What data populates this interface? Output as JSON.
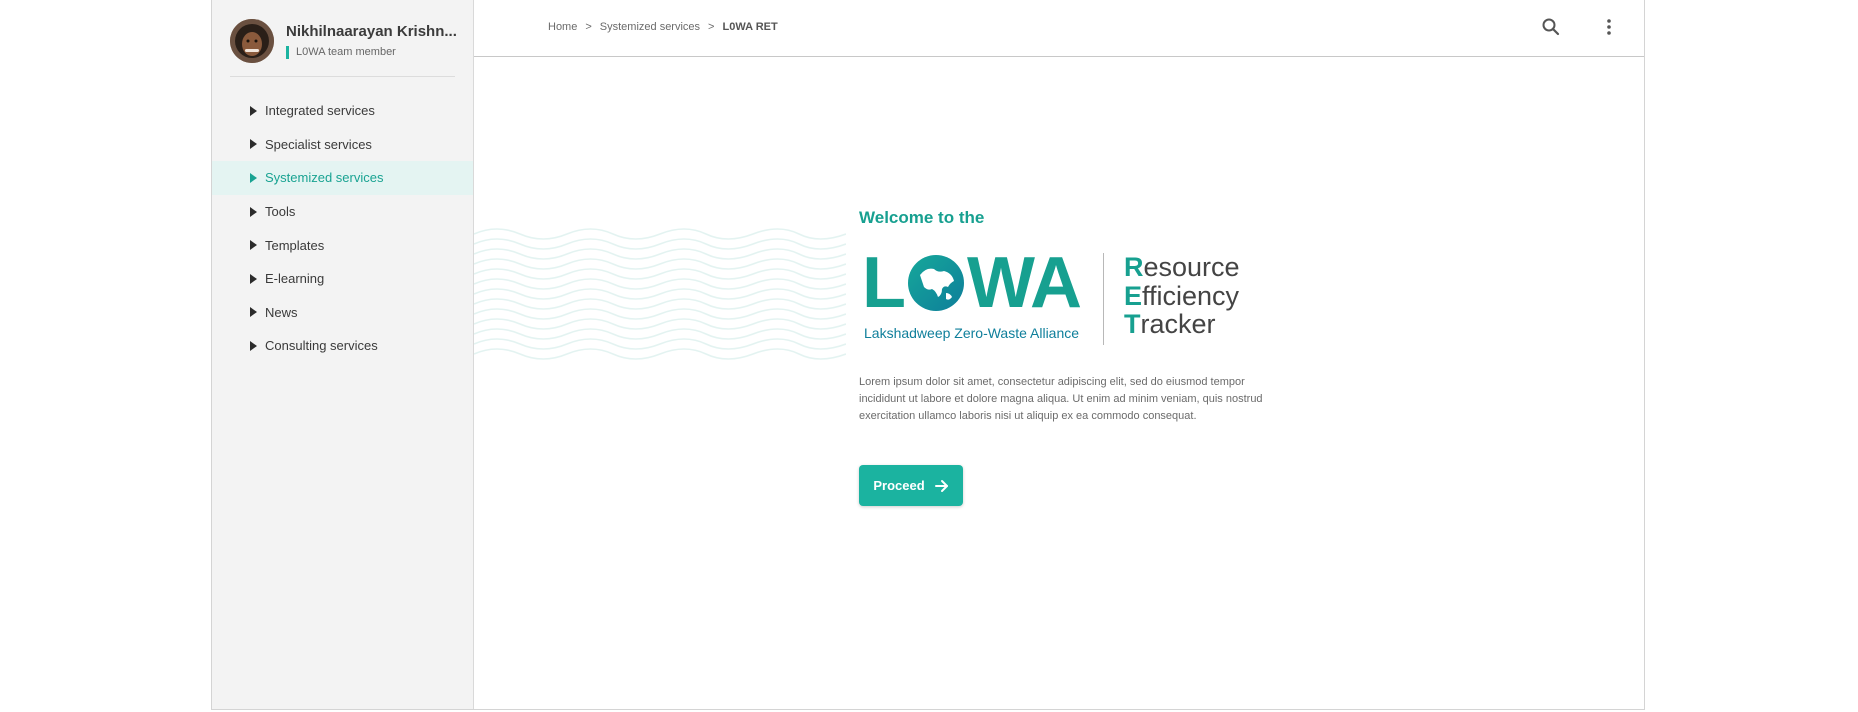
{
  "user": {
    "name": "Nikhilnaarayan  Krishn...",
    "role": "L0WA team member"
  },
  "nav": {
    "items": [
      {
        "label": "Integrated services"
      },
      {
        "label": "Specialist services"
      },
      {
        "label": "Systemized services",
        "active": true
      },
      {
        "label": "Tools"
      },
      {
        "label": "Templates"
      },
      {
        "label": "E-learning"
      },
      {
        "label": "News"
      },
      {
        "label": "Consulting services"
      }
    ]
  },
  "breadcrumb": {
    "home": "Home",
    "sep1": ">",
    "section": "Systemized services",
    "sep2": ">",
    "current": "L0WA RET"
  },
  "icons": {
    "search": "search-icon",
    "menu": "kebab-menu-icon",
    "proceed_arrow": "arrow-right-icon"
  },
  "welcome": "Welcome to the",
  "logo": {
    "word_left": "L",
    "word_right": "WA",
    "subtitle": "Lakshadweep Zero-Waste Alliance"
  },
  "ret": {
    "line1_initial": "R",
    "line1_rest": "esource",
    "line2_initial": "E",
    "line2_rest": "fficiency",
    "line3_initial": "T",
    "line3_rest": "racker"
  },
  "description": "Lorem ipsum dolor sit amet, consectetur adipiscing elit, sed do eiusmod tempor incididunt ut labore et dolore magna aliqua. Ut enim ad minim veniam, quis nostrud exercitation ullamco laboris nisi ut aliquip ex ea commodo consequat.",
  "proceed_label": "Proceed",
  "colors": {
    "accent": "#1bb3a0",
    "accent_dark": "#17a090",
    "logo_blue": "#0f7f9b",
    "sidebar_bg": "#f3f3f3"
  }
}
